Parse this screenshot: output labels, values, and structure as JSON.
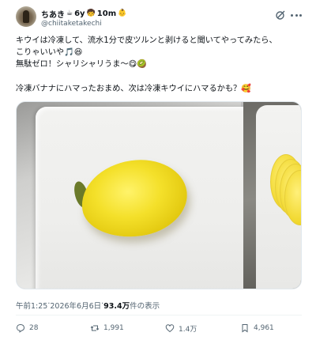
{
  "author": {
    "name": "ちあき",
    "badges": [
      "☕",
      "6y",
      "🧒",
      "10m",
      "👶"
    ],
    "handle": "@chiitaketakechi"
  },
  "post": {
    "lines": [
      "キウイは冷凍して、流水1分で皮ツルンと剥けると聞いてやってみたら、",
      "こりゃいいや🎵😆",
      "無駄ゼロ！シャリシャリうま〜😋🥝",
      "冷凍バナナにハマったおまめ、次は冷凍キウイにハマるかも？🥰"
    ]
  },
  "meta": {
    "time": "午前1:25",
    "sep": " · ",
    "date": "2026年6月6日",
    "views": "93.4万",
    "views_suffix": " 件の表示"
  },
  "stats": {
    "replies": "28",
    "reposts": "1,991",
    "likes": "1.4万",
    "bookmarks": "4,961"
  },
  "icons": [
    "grok-icon",
    "more-icon",
    "reply-icon",
    "repost-icon",
    "like-icon",
    "bookmark-icon"
  ]
}
